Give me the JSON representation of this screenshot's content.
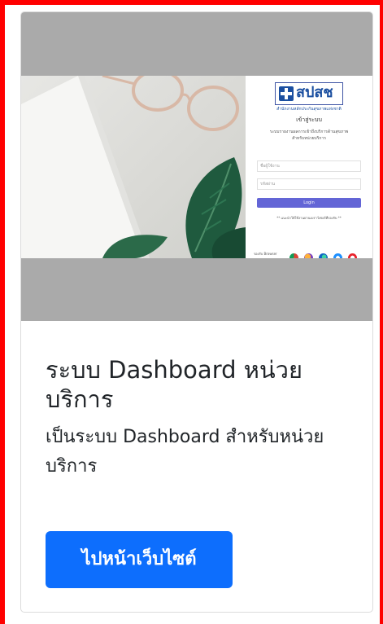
{
  "card": {
    "title": "ระบบ Dashboard หน่วยบริการ",
    "text": "เป็นระบบ Dashboard สำหรับหน่วยบริการ",
    "button_label": "ไปหน้าเว็บไซต์"
  },
  "preview": {
    "logo_text": "สปสช",
    "logo_subtitle": "สำนักงานหลักประกันสุขภาพแห่งชาติ",
    "login_heading": "เข้าสู่ระบบ",
    "login_desc_1": "ระบบรายงานผลการเข้าถึงบริการด้านสุขภาพ",
    "login_desc_2": "สำหรับหน่วยบริการ",
    "username_placeholder": "ชื่อผู้ใช้งาน",
    "password_placeholder": "รหัสผ่าน",
    "login_button": "Login",
    "notice": "** แนะนำให้ใช้งานผ่านเบราว์เซอร์ที่รองรับ **",
    "browsers_label": "รองรับ Browser"
  },
  "colors": {
    "frame": "#ff0000",
    "button": "#0d6efd",
    "image_bg": "#aaaaaa"
  },
  "icons": [
    "medical-cross-icon",
    "chrome-icon",
    "firefox-icon",
    "edge-icon",
    "safari-icon",
    "opera-icon"
  ]
}
